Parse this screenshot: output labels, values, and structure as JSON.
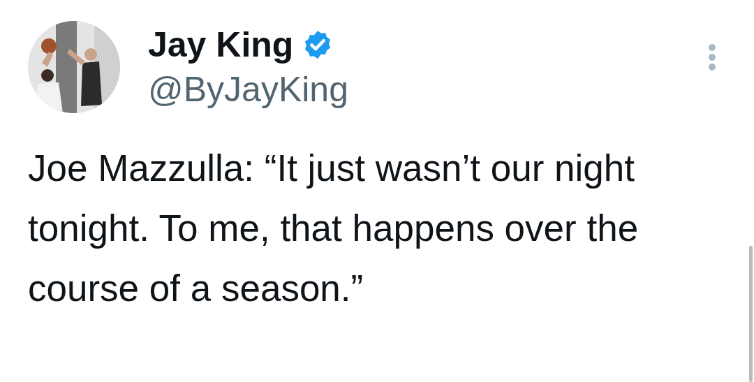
{
  "author": {
    "name": "Jay King",
    "verified": true,
    "handle": "@ByJayKing"
  },
  "tweet": {
    "text": "Joe Mazzulla: “It just wasn’t our night tonight. To me, that happens over the course of a season.”"
  }
}
